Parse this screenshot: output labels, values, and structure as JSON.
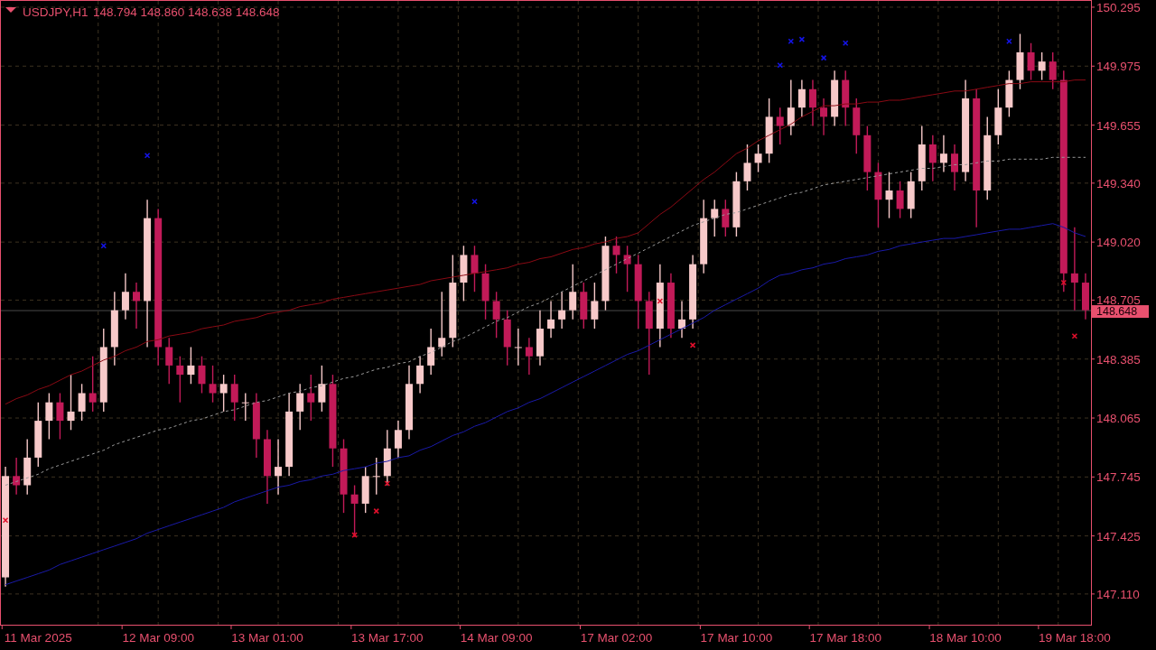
{
  "header": {
    "symbol": "USDJPY,H1",
    "quotes": "148.794 148.860 148.638 148.648"
  },
  "chart_data": {
    "type": "candlestick",
    "ylim": [
      146.943,
      150.334
    ],
    "grid": true,
    "ref_lines": [
      {
        "axis": "y",
        "value": 148.648,
        "label": "148.648"
      }
    ],
    "yticks": [
      {
        "value": 150.295,
        "label": "150.295"
      },
      {
        "value": 149.975,
        "label": "149.975"
      },
      {
        "value": 149.655,
        "label": "149.655"
      },
      {
        "value": 149.34,
        "label": "149.340"
      },
      {
        "value": 149.02,
        "label": "149.020"
      },
      {
        "value": 148.705,
        "label": "148.705"
      },
      {
        "value": 148.385,
        "label": "148.385"
      },
      {
        "value": 148.065,
        "label": "148.065"
      },
      {
        "value": 147.745,
        "label": "147.745"
      },
      {
        "value": 147.425,
        "label": "147.425"
      },
      {
        "value": 147.11,
        "label": "147.110"
      }
    ],
    "categories": [
      null,
      null,
      null,
      "11 Mar 2025",
      null,
      null,
      null,
      null,
      null,
      null,
      null,
      null,
      null,
      null,
      "12 Mar 09:00",
      null,
      null,
      null,
      null,
      null,
      null,
      null,
      null,
      null,
      "13 Mar 01:00",
      null,
      null,
      null,
      null,
      null,
      null,
      null,
      null,
      null,
      null,
      "13 Mar 17:00",
      null,
      null,
      null,
      null,
      null,
      null,
      null,
      null,
      null,
      "14 Mar 09:00",
      null,
      null,
      null,
      null,
      null,
      null,
      null,
      null,
      null,
      null,
      "17 Mar 02:00",
      null,
      null,
      null,
      null,
      null,
      null,
      null,
      null,
      null,
      null,
      "17 Mar 10:00",
      null,
      null,
      null,
      null,
      null,
      null,
      null,
      null,
      null,
      "17 Mar 18:00",
      null,
      null,
      null,
      null,
      null,
      null,
      null,
      null,
      null,
      null,
      "18 Mar 10:00",
      null,
      null,
      null,
      null,
      null,
      null,
      null,
      null,
      null,
      "19 Mar 18:00",
      null
    ],
    "ohlc": [
      [
        147.2,
        147.8,
        147.15,
        147.75
      ],
      [
        147.75,
        147.85,
        147.65,
        147.7
      ],
      [
        147.7,
        147.95,
        147.65,
        147.85
      ],
      [
        147.85,
        148.15,
        147.8,
        148.05
      ],
      [
        148.05,
        148.2,
        147.95,
        148.15
      ],
      [
        148.15,
        148.2,
        147.95,
        148.05
      ],
      [
        148.05,
        148.3,
        148.0,
        148.1
      ],
      [
        148.1,
        148.25,
        148.05,
        148.2
      ],
      [
        148.2,
        148.4,
        148.1,
        148.15
      ],
      [
        148.15,
        148.55,
        148.1,
        148.45
      ],
      [
        148.45,
        148.75,
        148.35,
        148.65
      ],
      [
        148.65,
        148.85,
        148.6,
        148.75
      ],
      [
        148.75,
        148.8,
        148.55,
        148.7
      ],
      [
        148.7,
        149.25,
        148.45,
        149.15
      ],
      [
        149.15,
        149.2,
        148.35,
        148.45
      ],
      [
        148.45,
        148.5,
        148.25,
        148.35
      ],
      [
        148.35,
        148.4,
        148.15,
        148.3
      ],
      [
        148.3,
        148.45,
        148.25,
        148.35
      ],
      [
        148.35,
        148.4,
        148.2,
        148.25
      ],
      [
        148.25,
        148.35,
        148.15,
        148.2
      ],
      [
        148.2,
        148.3,
        148.1,
        148.25
      ],
      [
        148.25,
        148.3,
        148.05,
        148.15
      ],
      [
        148.15,
        148.2,
        148.05,
        148.15
      ],
      [
        148.15,
        148.2,
        147.85,
        147.95
      ],
      [
        147.95,
        148.0,
        147.6,
        147.75
      ],
      [
        147.75,
        147.95,
        147.65,
        147.8
      ],
      [
        147.8,
        148.2,
        147.75,
        148.1
      ],
      [
        148.1,
        148.25,
        148.0,
        148.2
      ],
      [
        148.2,
        148.3,
        148.05,
        148.15
      ],
      [
        148.15,
        148.35,
        148.1,
        148.25
      ],
      [
        148.25,
        148.3,
        147.8,
        147.9
      ],
      [
        147.9,
        147.95,
        147.55,
        147.65
      ],
      [
        147.65,
        147.7,
        147.42,
        147.6
      ],
      [
        147.6,
        147.8,
        147.55,
        147.75
      ],
      [
        147.75,
        147.85,
        147.65,
        147.75
      ],
      [
        147.75,
        148.0,
        147.7,
        147.9
      ],
      [
        147.9,
        148.05,
        147.85,
        148.0
      ],
      [
        148.0,
        148.35,
        147.95,
        148.25
      ],
      [
        148.25,
        148.4,
        148.2,
        148.35
      ],
      [
        148.35,
        148.55,
        148.3,
        148.45
      ],
      [
        148.45,
        148.75,
        148.4,
        148.5
      ],
      [
        148.5,
        148.95,
        148.45,
        148.8
      ],
      [
        148.8,
        149.0,
        148.7,
        148.95
      ],
      [
        148.95,
        149.0,
        148.75,
        148.85
      ],
      [
        148.85,
        148.9,
        148.6,
        148.7
      ],
      [
        148.7,
        148.75,
        148.5,
        148.6
      ],
      [
        148.6,
        148.65,
        148.35,
        148.45
      ],
      [
        148.45,
        148.55,
        148.35,
        148.45
      ],
      [
        148.45,
        148.5,
        148.3,
        148.4
      ],
      [
        148.4,
        148.65,
        148.35,
        148.55
      ],
      [
        148.55,
        148.7,
        148.5,
        148.6
      ],
      [
        148.6,
        148.75,
        148.55,
        148.65
      ],
      [
        148.65,
        148.9,
        148.6,
        148.75
      ],
      [
        148.75,
        148.8,
        148.55,
        148.6
      ],
      [
        148.6,
        148.8,
        148.55,
        148.7
      ],
      [
        148.7,
        149.05,
        148.65,
        149.0
      ],
      [
        149.0,
        149.05,
        148.85,
        148.95
      ],
      [
        148.95,
        149.0,
        148.75,
        148.9
      ],
      [
        148.9,
        148.95,
        148.55,
        148.7
      ],
      [
        148.7,
        148.75,
        148.3,
        148.55
      ],
      [
        148.55,
        148.9,
        148.45,
        148.8
      ],
      [
        148.8,
        148.85,
        148.5,
        148.55
      ],
      [
        148.55,
        148.7,
        148.5,
        148.6
      ],
      [
        148.6,
        148.95,
        148.55,
        148.9
      ],
      [
        148.9,
        149.25,
        148.85,
        149.15
      ],
      [
        149.15,
        149.25,
        149.05,
        149.2
      ],
      [
        149.2,
        149.25,
        149.05,
        149.1
      ],
      [
        149.1,
        149.4,
        149.05,
        149.35
      ],
      [
        149.35,
        149.55,
        149.3,
        149.45
      ],
      [
        149.45,
        149.55,
        149.4,
        149.5
      ],
      [
        149.5,
        149.8,
        149.45,
        149.7
      ],
      [
        149.7,
        149.75,
        149.55,
        149.65
      ],
      [
        149.65,
        149.9,
        149.6,
        149.75
      ],
      [
        149.75,
        149.9,
        149.7,
        149.85
      ],
      [
        149.85,
        149.9,
        149.65,
        149.75
      ],
      [
        149.75,
        149.8,
        149.6,
        149.7
      ],
      [
        149.7,
        149.95,
        149.65,
        149.9
      ],
      [
        149.9,
        149.95,
        149.65,
        149.75
      ],
      [
        149.75,
        149.8,
        149.5,
        149.6
      ],
      [
        149.6,
        149.65,
        149.3,
        149.4
      ],
      [
        149.4,
        149.45,
        149.1,
        149.25
      ],
      [
        149.25,
        149.4,
        149.15,
        149.3
      ],
      [
        149.3,
        149.35,
        149.15,
        149.2
      ],
      [
        149.2,
        149.4,
        149.15,
        149.35
      ],
      [
        149.35,
        149.65,
        149.3,
        149.55
      ],
      [
        149.55,
        149.6,
        149.35,
        149.45
      ],
      [
        149.45,
        149.6,
        149.4,
        149.5
      ],
      [
        149.5,
        149.55,
        149.3,
        149.4
      ],
      [
        149.4,
        149.9,
        149.35,
        149.8
      ],
      [
        149.8,
        149.85,
        149.1,
        149.3
      ],
      [
        149.3,
        149.7,
        149.25,
        149.6
      ],
      [
        149.6,
        149.85,
        149.55,
        149.75
      ],
      [
        149.75,
        149.95,
        149.7,
        149.9
      ],
      [
        149.9,
        150.15,
        149.85,
        150.05
      ],
      [
        150.05,
        150.1,
        149.9,
        149.95
      ],
      [
        149.95,
        150.05,
        149.9,
        150.0
      ],
      [
        150.0,
        150.05,
        149.85,
        149.9
      ],
      [
        149.9,
        149.95,
        148.75,
        148.85
      ],
      [
        148.85,
        149.1,
        148.65,
        148.8
      ],
      [
        148.8,
        148.85,
        148.6,
        148.65
      ]
    ],
    "series": [
      {
        "type": "line",
        "color": "#8b0a14",
        "values": [
          148.14,
          148.17,
          148.19,
          148.22,
          148.24,
          148.27,
          148.3,
          148.32,
          148.35,
          148.38,
          148.4,
          148.43,
          148.45,
          148.48,
          148.49,
          148.51,
          148.52,
          148.53,
          148.55,
          148.56,
          148.57,
          148.59,
          148.6,
          148.61,
          148.63,
          148.64,
          148.65,
          148.67,
          148.68,
          148.69,
          148.71,
          148.72,
          148.73,
          148.74,
          148.75,
          148.76,
          148.77,
          148.78,
          148.79,
          148.81,
          148.82,
          148.83,
          148.84,
          148.85,
          148.86,
          148.87,
          148.88,
          148.9,
          148.91,
          148.93,
          148.94,
          148.96,
          148.98,
          148.99,
          149.01,
          149.02,
          149.04,
          149.05,
          149.07,
          149.12,
          149.17,
          149.21,
          149.26,
          149.31,
          149.36,
          149.4,
          149.45,
          149.5,
          149.53,
          149.57,
          149.6,
          149.63,
          149.66,
          149.7,
          149.73,
          149.76,
          149.76,
          149.77,
          149.77,
          149.78,
          149.78,
          149.79,
          149.79,
          149.8,
          149.81,
          149.82,
          149.83,
          149.84,
          149.84,
          149.85,
          149.86,
          149.87,
          149.88,
          149.88,
          149.89,
          149.89,
          149.89,
          149.89,
          149.9,
          149.9
        ]
      },
      {
        "type": "line",
        "color": "#9a9a9a",
        "line_style": "dashed",
        "values": [
          147.7,
          147.72,
          147.74,
          147.76,
          147.79,
          147.81,
          147.83,
          147.85,
          147.87,
          147.89,
          147.92,
          147.94,
          147.96,
          147.98,
          148.0,
          148.01,
          148.03,
          148.05,
          148.06,
          148.08,
          148.1,
          148.11,
          148.13,
          148.15,
          148.16,
          148.18,
          148.2,
          148.21,
          148.23,
          148.24,
          148.26,
          148.28,
          148.29,
          148.31,
          148.33,
          148.34,
          148.36,
          148.37,
          148.4,
          148.42,
          148.45,
          148.48,
          148.5,
          148.53,
          148.56,
          148.59,
          148.61,
          148.64,
          148.67,
          148.69,
          148.72,
          148.75,
          148.78,
          148.81,
          148.84,
          148.87,
          148.9,
          148.93,
          148.96,
          148.99,
          149.02,
          149.05,
          149.08,
          149.11,
          149.13,
          149.15,
          149.17,
          149.18,
          149.2,
          149.22,
          149.24,
          149.26,
          149.28,
          149.29,
          149.31,
          149.33,
          149.34,
          149.35,
          149.36,
          149.37,
          149.38,
          149.39,
          149.4,
          149.41,
          149.42,
          149.42,
          149.43,
          149.44,
          149.44,
          149.45,
          149.46,
          149.46,
          149.47,
          149.47,
          149.47,
          149.47,
          149.48,
          149.48,
          149.48,
          149.48
        ]
      },
      {
        "type": "line",
        "color": "#1a1aa8",
        "values": [
          147.16,
          147.18,
          147.2,
          147.22,
          147.24,
          147.27,
          147.29,
          147.31,
          147.33,
          147.35,
          147.37,
          147.39,
          147.41,
          147.44,
          147.46,
          147.48,
          147.5,
          147.52,
          147.54,
          147.56,
          147.58,
          147.61,
          147.63,
          147.65,
          147.67,
          147.69,
          147.7,
          147.72,
          147.73,
          147.75,
          147.76,
          147.78,
          147.79,
          147.8,
          147.82,
          147.83,
          147.85,
          147.86,
          147.89,
          147.91,
          147.94,
          147.97,
          147.99,
          148.02,
          148.04,
          148.07,
          148.1,
          148.12,
          148.15,
          148.17,
          148.2,
          148.23,
          148.26,
          148.29,
          148.32,
          148.35,
          148.38,
          148.41,
          148.43,
          148.46,
          148.49,
          148.52,
          148.55,
          148.58,
          148.61,
          148.65,
          148.68,
          148.71,
          148.74,
          148.77,
          148.81,
          148.84,
          148.85,
          148.87,
          148.88,
          148.9,
          148.91,
          148.93,
          148.94,
          148.95,
          148.97,
          148.98,
          149.0,
          149.01,
          149.02,
          149.03,
          149.04,
          149.04,
          149.05,
          149.06,
          149.07,
          149.08,
          149.09,
          149.09,
          149.1,
          149.11,
          149.12,
          149.1,
          149.07,
          149.05
        ]
      },
      {
        "type": "scatter",
        "color": "#1414e6",
        "values": [
          null,
          null,
          null,
          null,
          null,
          null,
          null,
          null,
          null,
          149.0,
          null,
          null,
          null,
          149.49,
          null,
          null,
          null,
          null,
          null,
          null,
          null,
          null,
          null,
          null,
          null,
          null,
          null,
          null,
          null,
          null,
          null,
          null,
          null,
          null,
          null,
          null,
          null,
          null,
          null,
          null,
          null,
          null,
          null,
          149.24,
          null,
          null,
          null,
          null,
          null,
          null,
          null,
          null,
          null,
          null,
          null,
          null,
          null,
          null,
          null,
          null,
          null,
          null,
          null,
          null,
          null,
          null,
          null,
          null,
          null,
          null,
          null,
          149.98,
          150.11,
          150.12,
          null,
          150.02,
          null,
          150.1,
          null,
          null,
          null,
          null,
          null,
          null,
          null,
          null,
          null,
          null,
          null,
          null,
          null,
          null,
          150.11,
          null,
          null,
          null,
          null,
          null,
          null,
          null
        ]
      },
      {
        "type": "scatter",
        "color": "#e0102c",
        "values": [
          147.51,
          null,
          null,
          null,
          null,
          null,
          null,
          null,
          null,
          null,
          null,
          null,
          null,
          null,
          null,
          null,
          null,
          null,
          null,
          null,
          null,
          null,
          null,
          null,
          null,
          null,
          null,
          null,
          null,
          null,
          null,
          null,
          147.43,
          null,
          147.56,
          147.71,
          null,
          null,
          null,
          null,
          null,
          null,
          null,
          null,
          null,
          null,
          null,
          null,
          null,
          null,
          null,
          null,
          null,
          null,
          null,
          null,
          null,
          null,
          null,
          null,
          148.7,
          null,
          null,
          148.46,
          null,
          null,
          null,
          null,
          null,
          null,
          null,
          null,
          null,
          null,
          null,
          null,
          null,
          null,
          null,
          null,
          null,
          null,
          null,
          null,
          null,
          null,
          null,
          null,
          null,
          null,
          null,
          null,
          null,
          null,
          null,
          null,
          null,
          148.8,
          148.51,
          null
        ]
      }
    ]
  }
}
